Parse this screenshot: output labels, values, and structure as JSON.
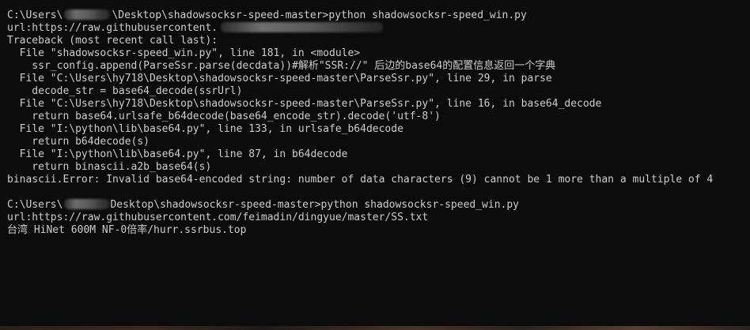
{
  "terminal": {
    "lines": {
      "l1_prefix": "C:\\Users\\",
      "l1_suffix": "\\Desktop\\shadowsocksr-speed-master>python shadowsocksr-speed_win.py",
      "l2_prefix": "url:https://raw.githubusercontent.",
      "l3": "Traceback (most recent call last):",
      "l4": "  File \"shadowsocksr-speed_win.py\", line 181, in <module>",
      "l5": "    ssr_config.append(ParseSsr.parse(decdata))#解析\"SSR://\" 后边的base64的配置信息返回一个字典",
      "l6": "  File \"C:\\Users\\hy718\\Desktop\\shadowsocksr-speed-master\\ParseSsr.py\", line 29, in parse",
      "l7": "    decode_str = base64_decode(ssrUrl)",
      "l8": "  File \"C:\\Users\\hy718\\Desktop\\shadowsocksr-speed-master\\ParseSsr.py\", line 16, in base64_decode",
      "l9": "    return base64.urlsafe_b64decode(base64_encode_str).decode('utf-8')",
      "l10": "  File \"I:\\python\\lib\\base64.py\", line 133, in urlsafe_b64decode",
      "l11": "    return b64decode(s)",
      "l12": "  File \"I:\\python\\lib\\base64.py\", line 87, in b64decode",
      "l13": "    return binascii.a2b_base64(s)",
      "l14": "binascii.Error: Invalid base64-encoded string: number of data characters (9) cannot be 1 more than a multiple of 4",
      "l16_prefix": "C:\\Users\\",
      "l16_suffix": "Desktop\\shadowsocksr-speed-master>python shadowsocksr-speed_win.py",
      "l17": "url:https://raw.githubusercontent.com/feimadin/dingyue/master/SS.txt",
      "l18": "台湾 HiNet 600M NF-0倍率/hurr.ssrbus.top"
    }
  }
}
